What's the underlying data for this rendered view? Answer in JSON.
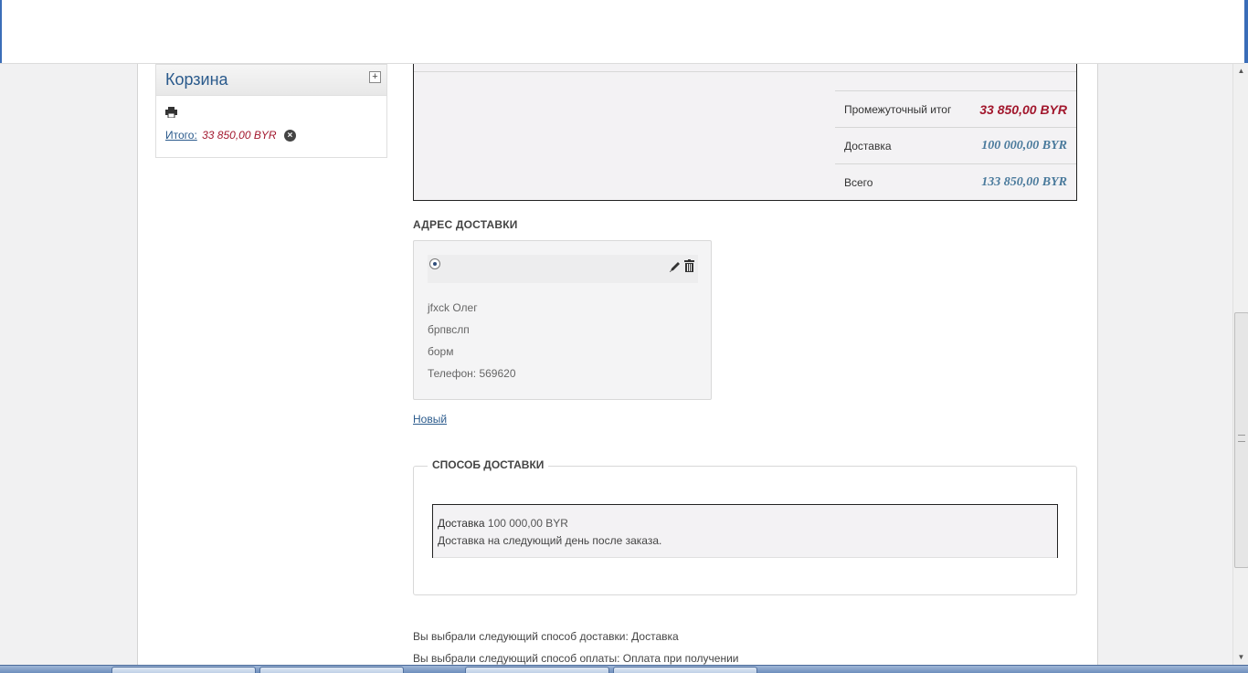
{
  "cart_module": {
    "title": "Корзина",
    "expand_symbol": "+",
    "total_label": "Итого:",
    "total_value": "33 850,00 BYR",
    "remove_symbol": "×"
  },
  "totals": {
    "subtotal_label": "Промежуточный итог",
    "subtotal_value": "33 850,00 BYR",
    "shipping_label": "Доставка",
    "shipping_value": "100 000,00 BYR",
    "grand_label": "Всего",
    "grand_value": "133 850,00 BYR"
  },
  "address_section": {
    "title": "АДРЕС ДОСТАВКИ",
    "lines": [
      "jfxck Олег",
      "брпвслп",
      "борм",
      "Телефон: 569620"
    ],
    "new_link": "Новый"
  },
  "shipping_method": {
    "title": "СПОСОБ ДОСТАВКИ",
    "option_name": "Доставка",
    "option_price": "100 000,00 BYR",
    "option_description": "Доставка на следующий день после заказа."
  },
  "summary": {
    "shipping_line": "Вы выбрали следующий способ доставки: Доставка",
    "payment_line": "Вы выбрали следующий способ оплаты: Оплата при получении"
  },
  "scrollbar": {
    "up_arrow": "▲",
    "down_arrow": "▼"
  },
  "colors": {
    "accent_red": "#a2172d",
    "link_blue": "#2a5a8c",
    "value_blue": "#4a7a9c"
  }
}
